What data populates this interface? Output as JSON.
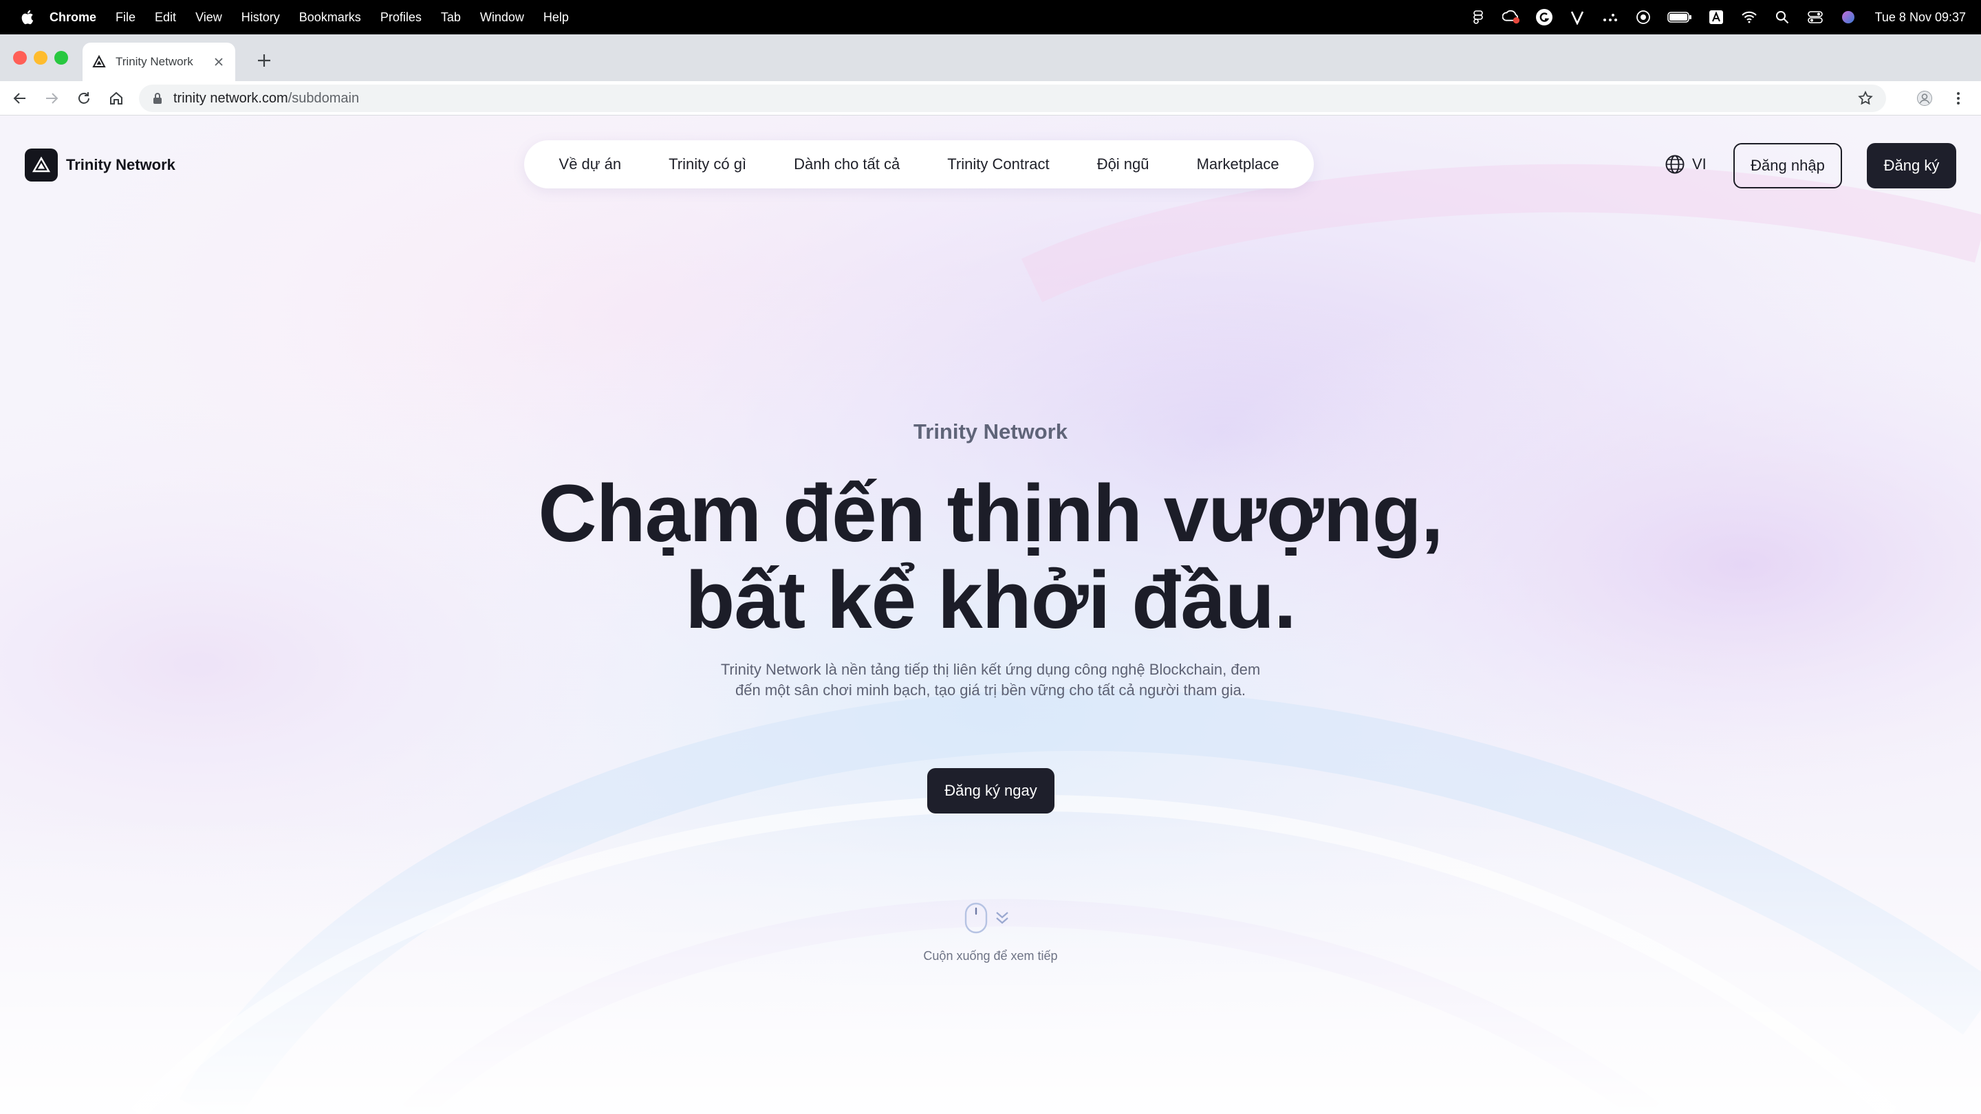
{
  "menubar": {
    "app_name": "Chrome",
    "items": [
      "File",
      "Edit",
      "View",
      "History",
      "Bookmarks",
      "Profiles",
      "Tab",
      "Window",
      "Help"
    ],
    "clock": "Tue 8 Nov  09:37",
    "status_icons": [
      "figma-icon",
      "creative-cloud-icon",
      "grammarly-icon",
      "v-icon",
      "dots-icon",
      "play-circle-icon",
      "battery-icon",
      "keyboard-a-icon",
      "wifi-icon",
      "search-icon",
      "control-center-icon",
      "siri-icon"
    ]
  },
  "browser": {
    "tab_title": "Trinity Network",
    "url_host": "trinity network.com",
    "url_path": "/subdomain"
  },
  "site": {
    "brand": "Trinity Network",
    "nav": [
      "Về dự án",
      "Trinity có gì",
      "Dành cho tất cả",
      "Trinity Contract",
      "Đội ngũ",
      "Marketplace"
    ],
    "language": "VI",
    "login_label": "Đăng nhập",
    "signup_label": "Đăng ký"
  },
  "hero": {
    "eyebrow": "Trinity Network",
    "headline_line1": "Chạm đến thịnh vượng,",
    "headline_line2": "bất kể khởi đầu.",
    "description_line1": "Trinity Network là nền tảng tiếp thị liên kết ứng dụng công nghệ Blockchain, đem",
    "description_line2": "đến một sân chơi minh bạch, tạo giá trị bền vững cho tất cả người tham gia.",
    "cta_label": "Đăng ký ngay",
    "scroll_hint": "Cuộn xuống để xem tiếp"
  },
  "colors": {
    "dark": "#1e1f2b",
    "text_muted": "#5e6274",
    "tab_strip": "#dee1e6"
  }
}
